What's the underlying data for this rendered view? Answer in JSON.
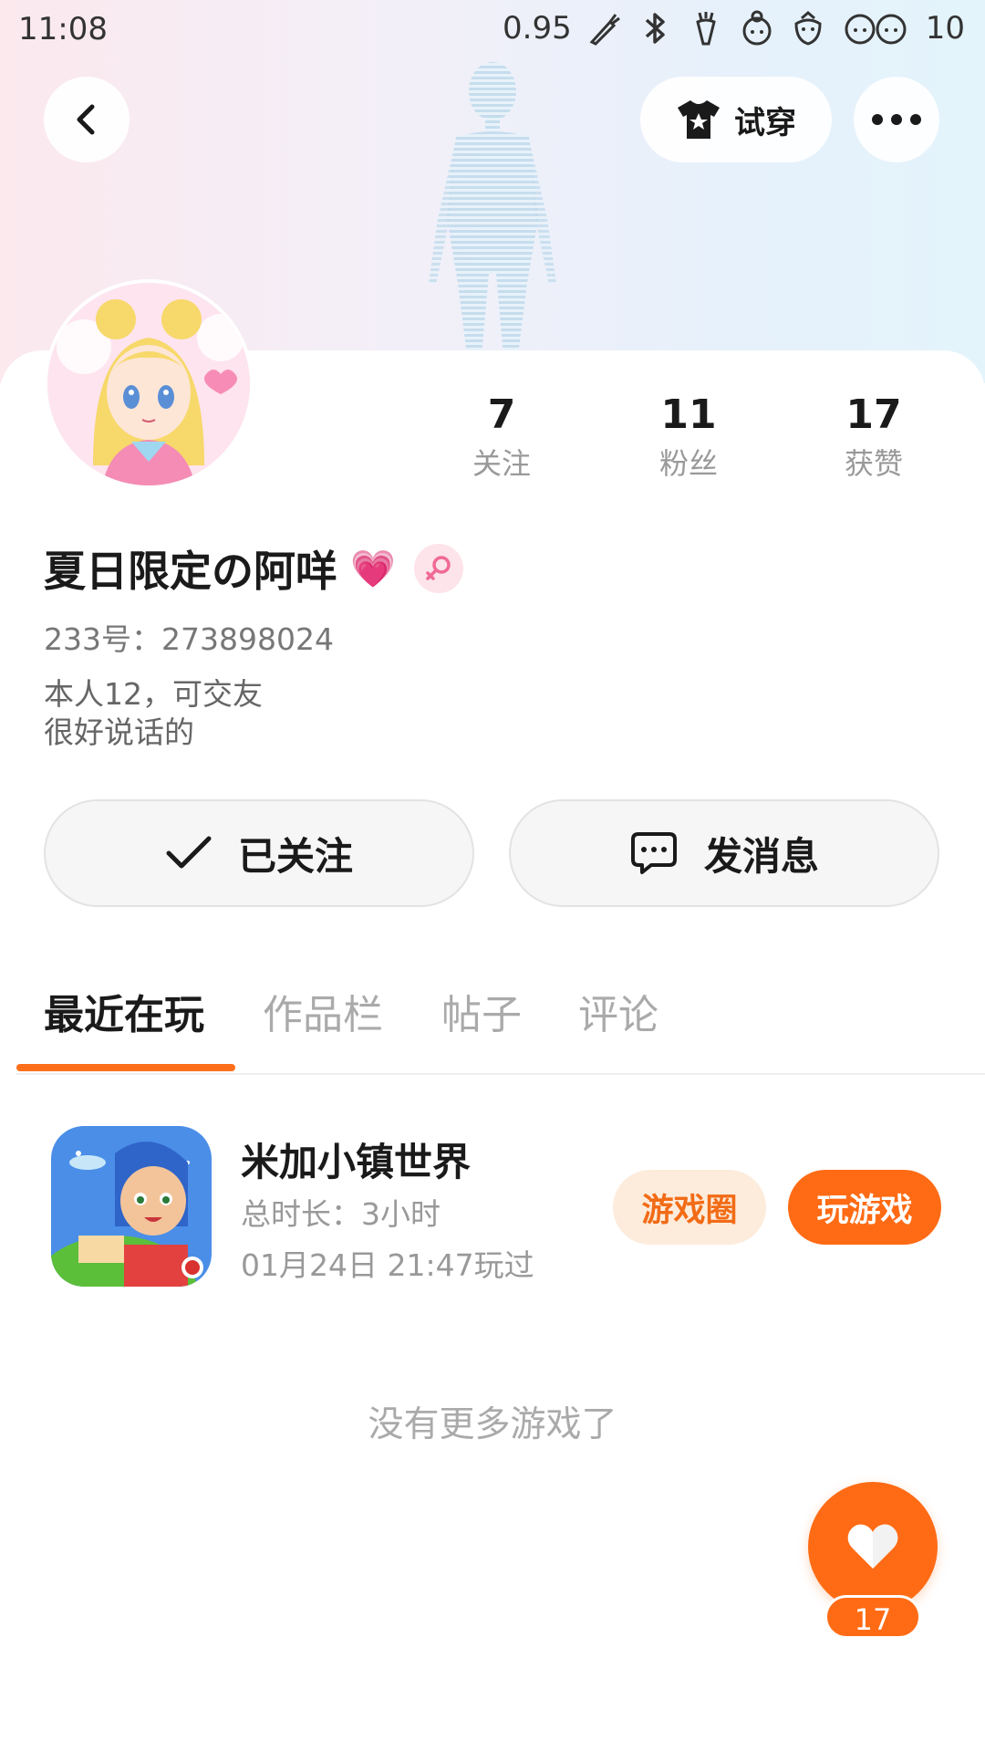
{
  "status_bar": {
    "time": "11:08",
    "network_speed": "0.95",
    "battery": "10",
    "icons": [
      "carrot-brush-icon",
      "bluetooth-icon",
      "carrot-icon",
      "girl-face-icon",
      "strawberry-icon",
      "girls-faces-icon"
    ]
  },
  "header": {
    "try_on_label": "试穿",
    "back_icon": "chevron-left-icon",
    "more_icon": "more-dots-icon",
    "try_on_icon": "tshirt-star-icon"
  },
  "profile": {
    "username": "夏日限定の阿咩",
    "username_emoji": "💗",
    "gender": "female",
    "uid_text": "233号：273898024",
    "bio_lines": [
      "本人12，可交友",
      "很好说话的"
    ],
    "stats": [
      {
        "value": "7",
        "label": "关注"
      },
      {
        "value": "11",
        "label": "粉丝"
      },
      {
        "value": "17",
        "label": "获赞"
      }
    ]
  },
  "actions": {
    "followed_label": "已关注",
    "message_label": "发消息"
  },
  "tabs": [
    {
      "label": "最近在玩",
      "active": true
    },
    {
      "label": "作品栏",
      "active": false
    },
    {
      "label": "帖子",
      "active": false
    },
    {
      "label": "评论",
      "active": false
    }
  ],
  "recent_game": {
    "title": "米加小镇世界",
    "duration": "总时长：3小时",
    "last_played": "01月24日 21:47玩过",
    "circle_label": "游戏圈",
    "play_label": "玩游戏"
  },
  "no_more_text": "没有更多游戏了",
  "like_button": {
    "count": "17"
  },
  "colors": {
    "accent": "#ff6b14",
    "accent_light": "#fdecdc",
    "text_primary": "#1a1a1a",
    "text_secondary": "#999999"
  }
}
